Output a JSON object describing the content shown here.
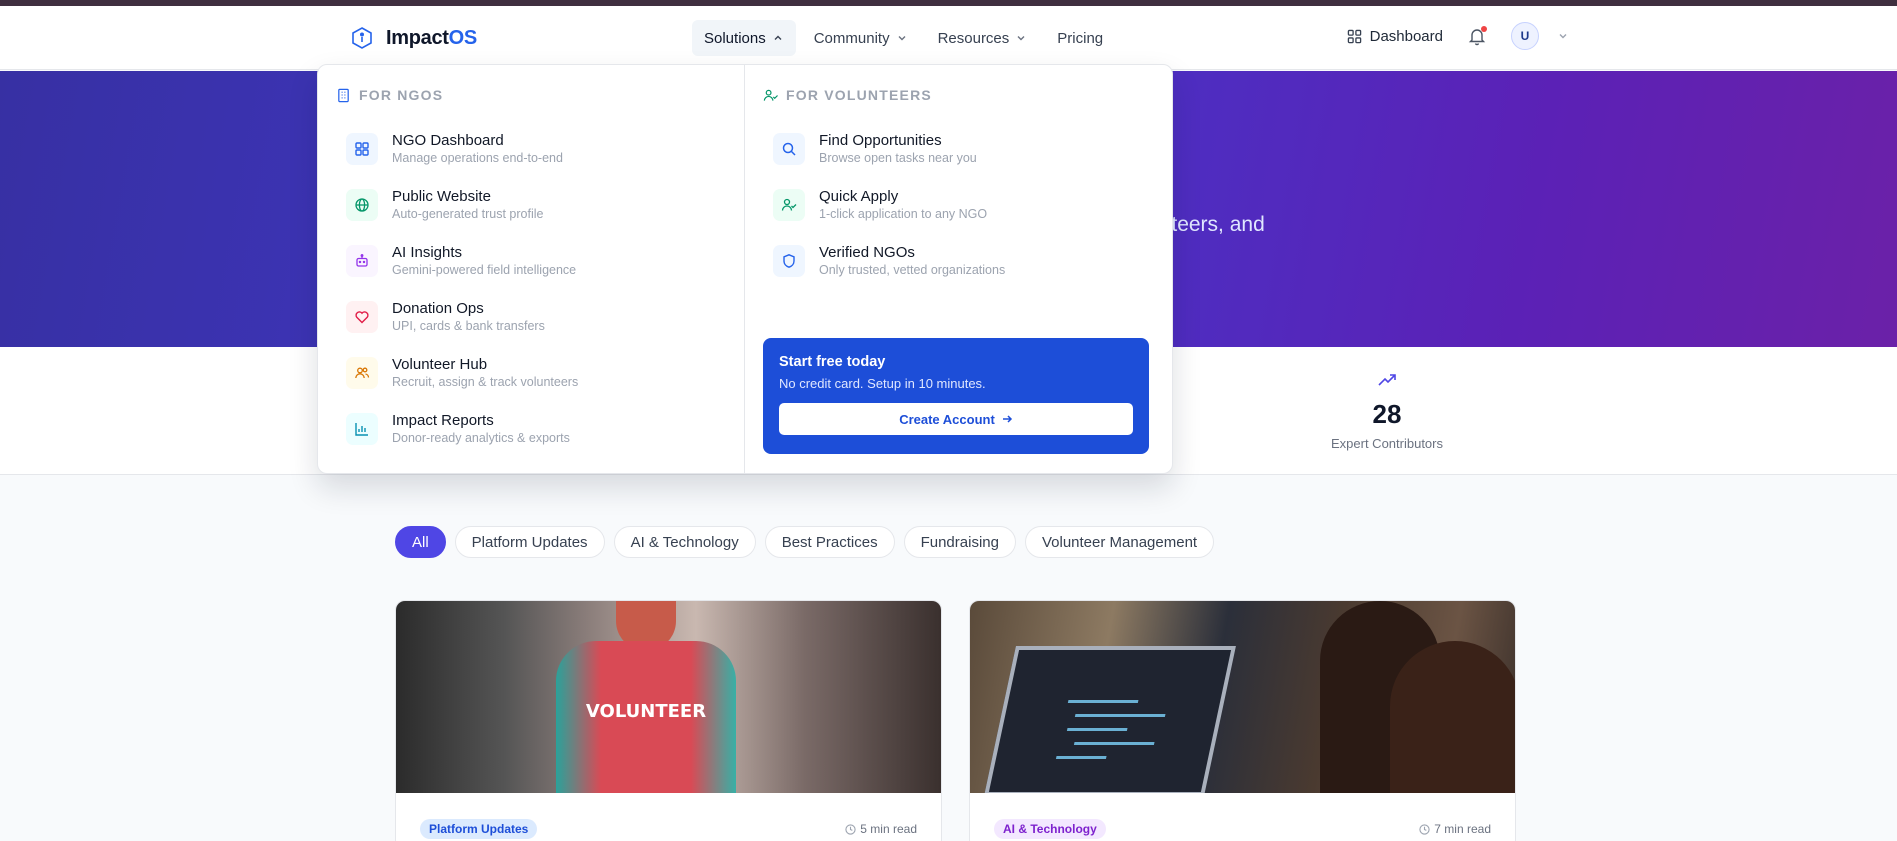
{
  "brand": {
    "name_main": "Impact",
    "name_accent": "OS",
    "accent_color": "#2563eb"
  },
  "nav": {
    "items": [
      {
        "label": "Solutions",
        "active": true,
        "has_chevron": true
      },
      {
        "label": "Community",
        "active": false,
        "has_chevron": true
      },
      {
        "label": "Resources",
        "active": false,
        "has_chevron": true
      },
      {
        "label": "Pricing",
        "active": false,
        "has_chevron": false
      }
    ],
    "dashboard_label": "Dashboard",
    "avatar_initial": "U",
    "notification_icon": "bell-icon"
  },
  "hero": {
    "visible_text": "unteers, and"
  },
  "stats": {
    "expert_value": "28",
    "expert_label": "Expert Contributors",
    "icon": "trending-up-icon"
  },
  "dropdown": {
    "ngos_heading": "FOR NGOS",
    "volunteers_heading": "FOR VOLUNTEERS",
    "ngo_items": [
      {
        "title": "NGO Dashboard",
        "desc": "Manage operations end-to-end",
        "icon": "grid-icon",
        "color": "#2563eb",
        "bg": "#eff6ff"
      },
      {
        "title": "Public Website",
        "desc": "Auto-generated trust profile",
        "icon": "globe-icon",
        "color": "#059669",
        "bg": "#ecfdf5"
      },
      {
        "title": "AI Insights",
        "desc": "Gemini-powered field intelligence",
        "icon": "bot-icon",
        "color": "#9333ea",
        "bg": "#faf5ff"
      },
      {
        "title": "Donation Ops",
        "desc": "UPI, cards & bank transfers",
        "icon": "heart-icon",
        "color": "#e11d48",
        "bg": "#fff1f2"
      },
      {
        "title": "Volunteer Hub",
        "desc": "Recruit, assign & track volunteers",
        "icon": "users-icon",
        "color": "#d97706",
        "bg": "#fffbeb"
      },
      {
        "title": "Impact Reports",
        "desc": "Donor-ready analytics & exports",
        "icon": "bar-chart-icon",
        "color": "#0891b2",
        "bg": "#ecfeff"
      }
    ],
    "volunteer_items": [
      {
        "title": "Find Opportunities",
        "desc": "Browse open tasks near you",
        "icon": "search-icon",
        "color": "#2563eb",
        "bg": "#eff6ff"
      },
      {
        "title": "Quick Apply",
        "desc": "1-click application to any NGO",
        "icon": "user-check-icon",
        "color": "#059669",
        "bg": "#ecfdf5"
      },
      {
        "title": "Verified NGOs",
        "desc": "Only trusted, vetted organizations",
        "icon": "shield-icon",
        "color": "#2563eb",
        "bg": "#eff6ff"
      }
    ],
    "cta": {
      "title": "Start free today",
      "subtitle": "No credit card. Setup in 10 minutes.",
      "button_label": "Create Account",
      "color": "#1d4ed8"
    }
  },
  "filters": {
    "chips": [
      "All",
      "Platform Updates",
      "AI & Technology",
      "Best Practices",
      "Fundraising",
      "Volunteer Management"
    ],
    "active": "All",
    "active_color": "#4f46e5"
  },
  "cards": [
    {
      "category": "Platform Updates",
      "read_time": "5 min read",
      "image_text": "VOLUNTEER"
    },
    {
      "category": "AI & Technology",
      "read_time": "7 min read"
    }
  ]
}
